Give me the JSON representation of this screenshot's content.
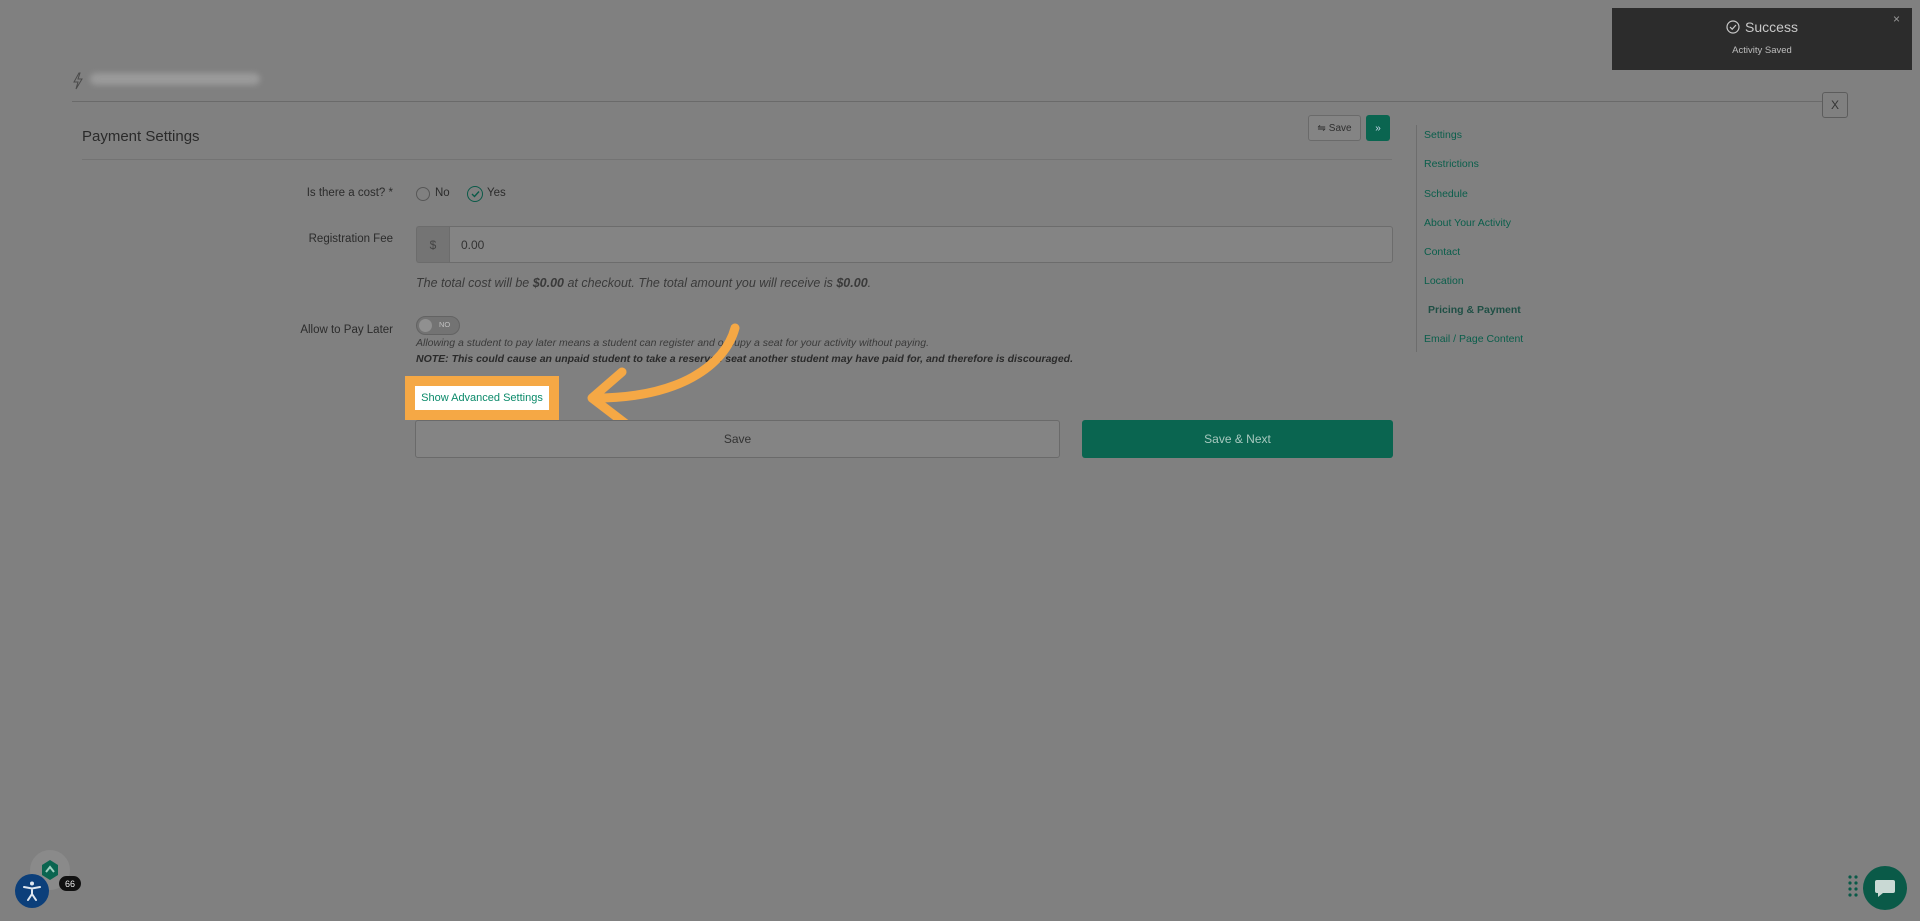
{
  "header": {
    "close_label": "X"
  },
  "section": {
    "title": "Payment Settings"
  },
  "toolbar": {
    "save_label": "Save",
    "next_label": "»"
  },
  "form": {
    "cost": {
      "label": "Is there a cost? *",
      "options": [
        "No",
        "Yes"
      ],
      "selected": "Yes"
    },
    "fee": {
      "label": "Registration Fee",
      "prefix": "$",
      "value": "0.00"
    },
    "total": {
      "pre": "The total cost will be ",
      "amount1": "$0.00",
      "mid": " at checkout. The total amount you will receive is ",
      "amount2": "$0.00",
      "post": "."
    },
    "pay_later": {
      "label": "Allow to Pay Later",
      "toggle_text": "NO",
      "note1": "Allowing a student to pay later means a student can register and occupy a seat for your activity without paying.",
      "note2": "NOTE: This could cause an unpaid student to take a reserved seat another student may have paid for, and therefore is discouraged."
    },
    "advanced_link": "Show Advanced Settings",
    "save_label": "Save",
    "save_next_label": "Save & Next"
  },
  "sidebar": {
    "items": [
      {
        "label": "Settings"
      },
      {
        "label": "Restrictions"
      },
      {
        "label": "Schedule"
      },
      {
        "label": "About Your Activity"
      },
      {
        "label": "Contact"
      },
      {
        "label": "Location"
      },
      {
        "label": "Pricing & Payment"
      },
      {
        "label": "Email / Page Content"
      }
    ],
    "active": "Pricing & Payment"
  },
  "toast": {
    "title": "Success",
    "message": "Activity Saved",
    "close": "×"
  },
  "widgets": {
    "badge_count": "66"
  },
  "colors": {
    "accent": "#0a6550",
    "highlight": "#f5a845",
    "link": "#0b8a6a"
  }
}
